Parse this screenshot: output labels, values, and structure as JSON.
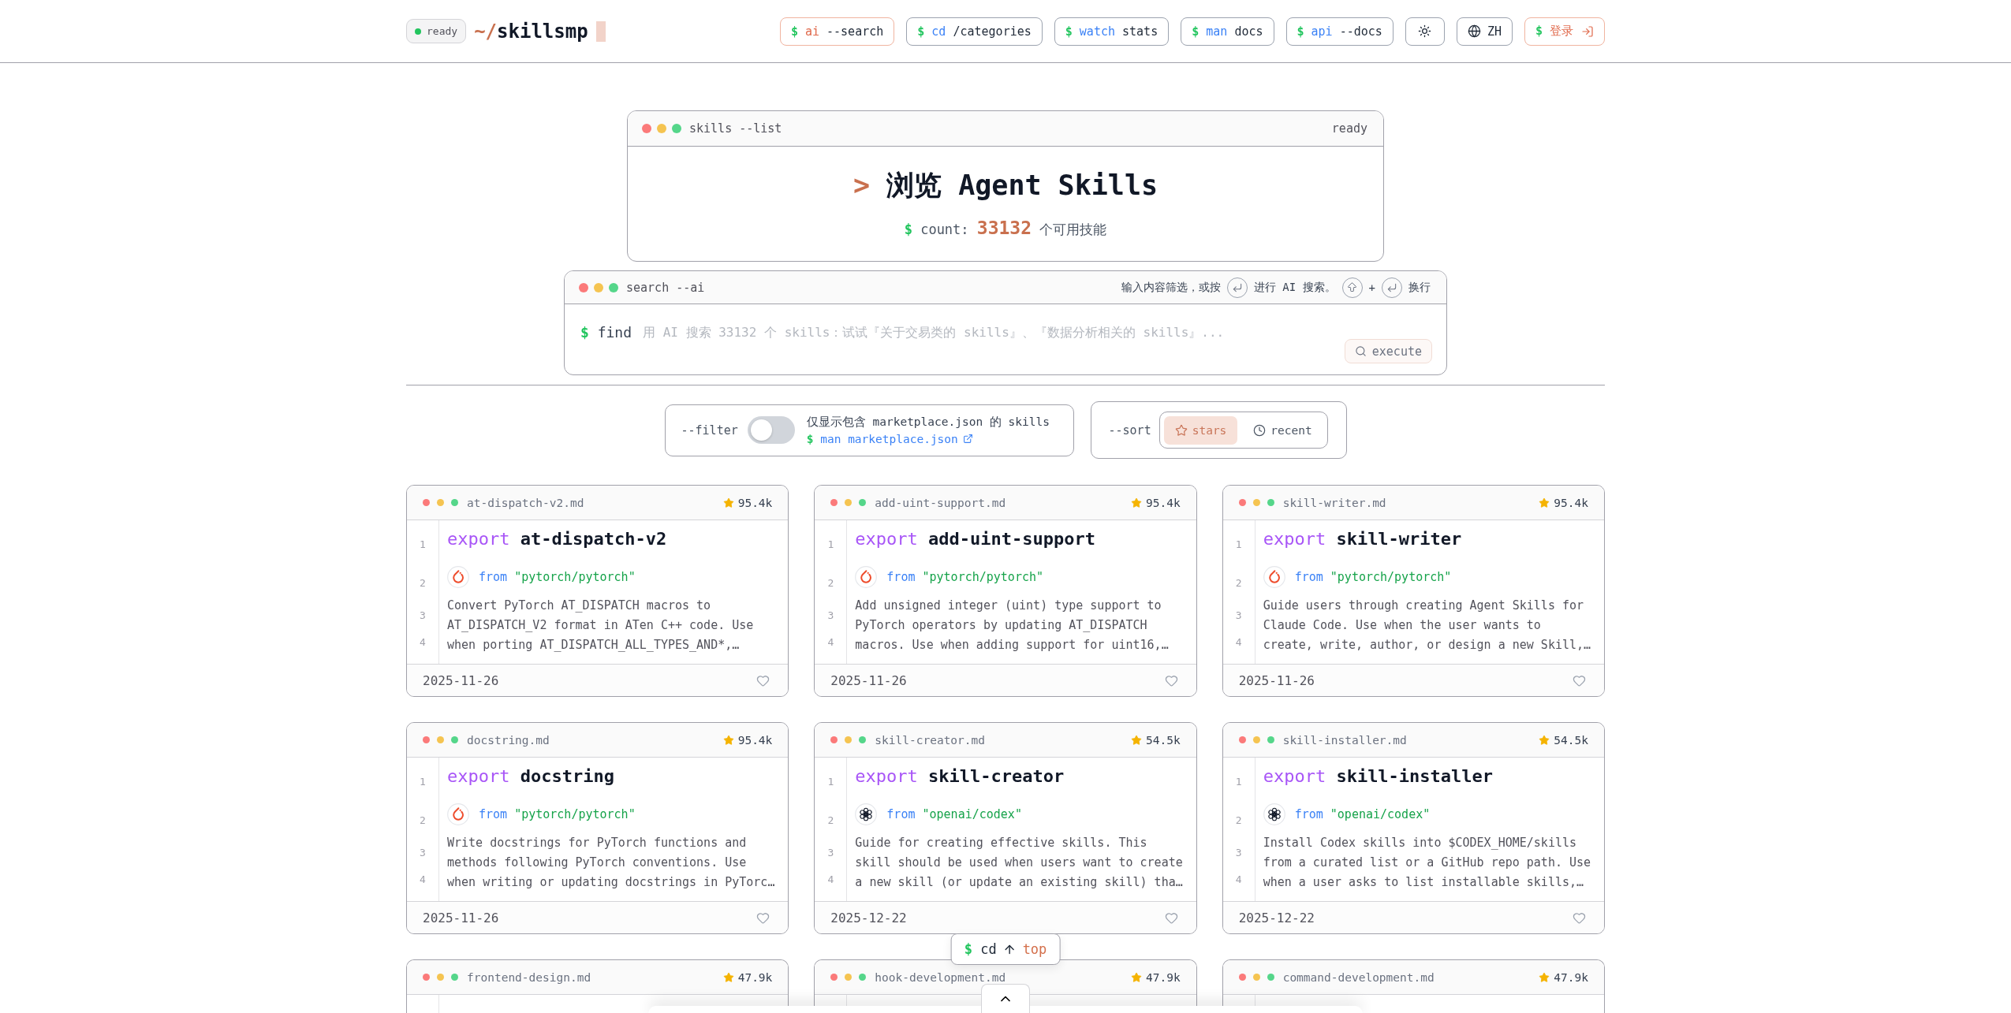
{
  "header": {
    "status": {
      "label": "ready"
    },
    "logo": {
      "prefix": "~/",
      "name": "skillsmp"
    },
    "nav": [
      {
        "kind": "ai",
        "prompt": "$",
        "command": "ai",
        "arg": "--search"
      },
      {
        "kind": "cmd",
        "prompt": "$",
        "command": "cd",
        "arg": "/categories"
      },
      {
        "kind": "cmd",
        "prompt": "$",
        "command": "watch",
        "arg": "stats"
      },
      {
        "kind": "cmd",
        "prompt": "$",
        "command": "man",
        "arg": "docs"
      },
      {
        "kind": "cmd",
        "prompt": "$",
        "command": "api",
        "arg": "--docs"
      }
    ],
    "language": "ZH",
    "login": {
      "prompt": "$",
      "label": "登录"
    }
  },
  "hero": {
    "window_title": "skills --list",
    "status": "ready",
    "prompt": ">",
    "title": "浏览 Agent Skills",
    "count_prompt": "$",
    "count_label": "count:",
    "count": "33132",
    "count_suffix": "个可用技能"
  },
  "search": {
    "window_title": "search --ai",
    "hint_start": "输入内容筛选，或按",
    "hint_middle": "进行 AI 搜索。",
    "hint_plus": "+",
    "hint_end": "换行",
    "prompt": "$",
    "label": "find",
    "placeholder": "用 AI 搜索 33132 个 skills：试试『关于交易类的 skills』、『数据分析相关的 skills』...",
    "button": "execute"
  },
  "filter": {
    "label": "--filter",
    "on": false,
    "text": "仅显示包含 marketplace.json 的 skills",
    "link_prompt": "$",
    "link": "man marketplace.json"
  },
  "sort": {
    "label": "--sort",
    "options": [
      {
        "kind": "star",
        "label": "stars",
        "selected": true
      },
      {
        "kind": "clock",
        "label": "recent",
        "selected": false
      }
    ]
  },
  "cards": [
    {
      "file": "at-dispatch-v2.md",
      "star_count": "95.4k",
      "line_numbers": [
        "1",
        "2",
        "3",
        "4"
      ],
      "keyword": "export",
      "name": "at-dispatch-v2",
      "source": {
        "kind": "flame",
        "keyword": "from",
        "repo": "\"pytorch/pytorch\""
      },
      "description": "Convert PyTorch AT_DISPATCH macros to AT_DISPATCH_V2 format in ATen C++ code. Use when porting AT_DISPATCH_ALL_TYPES_AND*,…",
      "date": "2025-11-26",
      "favorited": false
    },
    {
      "file": "add-uint-support.md",
      "star_count": "95.4k",
      "line_numbers": [
        "1",
        "2",
        "3",
        "4"
      ],
      "keyword": "export",
      "name": "add-uint-support",
      "source": {
        "kind": "flame",
        "keyword": "from",
        "repo": "\"pytorch/pytorch\""
      },
      "description": "Add unsigned integer (uint) type support to PyTorch operators by updating AT_DISPATCH macros. Use when adding support for uint16,…",
      "date": "2025-11-26",
      "favorited": false
    },
    {
      "file": "skill-writer.md",
      "star_count": "95.4k",
      "line_numbers": [
        "1",
        "2",
        "3",
        "4"
      ],
      "keyword": "export",
      "name": "skill-writer",
      "source": {
        "kind": "flame",
        "keyword": "from",
        "repo": "\"pytorch/pytorch\""
      },
      "description": "Guide users through creating Agent Skills for Claude Code. Use when the user wants to create, write, author, or design a new Skill,…",
      "date": "2025-11-26",
      "favorited": false
    },
    {
      "file": "docstring.md",
      "star_count": "95.4k",
      "line_numbers": [
        "1",
        "2",
        "3",
        "4"
      ],
      "keyword": "export",
      "name": "docstring",
      "source": {
        "kind": "flame",
        "keyword": "from",
        "repo": "\"pytorch/pytorch\""
      },
      "description": "Write docstrings for PyTorch functions and methods following PyTorch conventions. Use when writing or updating docstrings in PyTorc…",
      "date": "2025-11-26",
      "favorited": false
    },
    {
      "file": "skill-creator.md",
      "star_count": "54.5k",
      "line_numbers": [
        "1",
        "2",
        "3",
        "4"
      ],
      "keyword": "export",
      "name": "skill-creator",
      "source": {
        "kind": "knot",
        "keyword": "from",
        "repo": "\"openai/codex\""
      },
      "description": "Guide for creating effective skills. This skill should be used when users want to create a new skill (or update an existing skill) tha…",
      "date": "2025-12-22",
      "favorited": false
    },
    {
      "file": "skill-installer.md",
      "star_count": "54.5k",
      "line_numbers": [
        "1",
        "2",
        "3",
        "4"
      ],
      "keyword": "export",
      "name": "skill-installer",
      "source": {
        "kind": "knot",
        "keyword": "from",
        "repo": "\"openai/codex\""
      },
      "description": "Install Codex skills into $CODEX_HOME/skills from a curated list or a GitHub repo path. Use when a user asks to list installable skills,…",
      "date": "2025-12-22",
      "favorited": false
    },
    {
      "file": "frontend-design.md",
      "star_count": "47.9k"
    },
    {
      "file": "hook-development.md",
      "star_count": "47.9k"
    },
    {
      "file": "command-development.md",
      "star_count": "47.9k"
    }
  ],
  "back_to_top": {
    "prompt": "$",
    "command": "cd",
    "target": "top"
  }
}
